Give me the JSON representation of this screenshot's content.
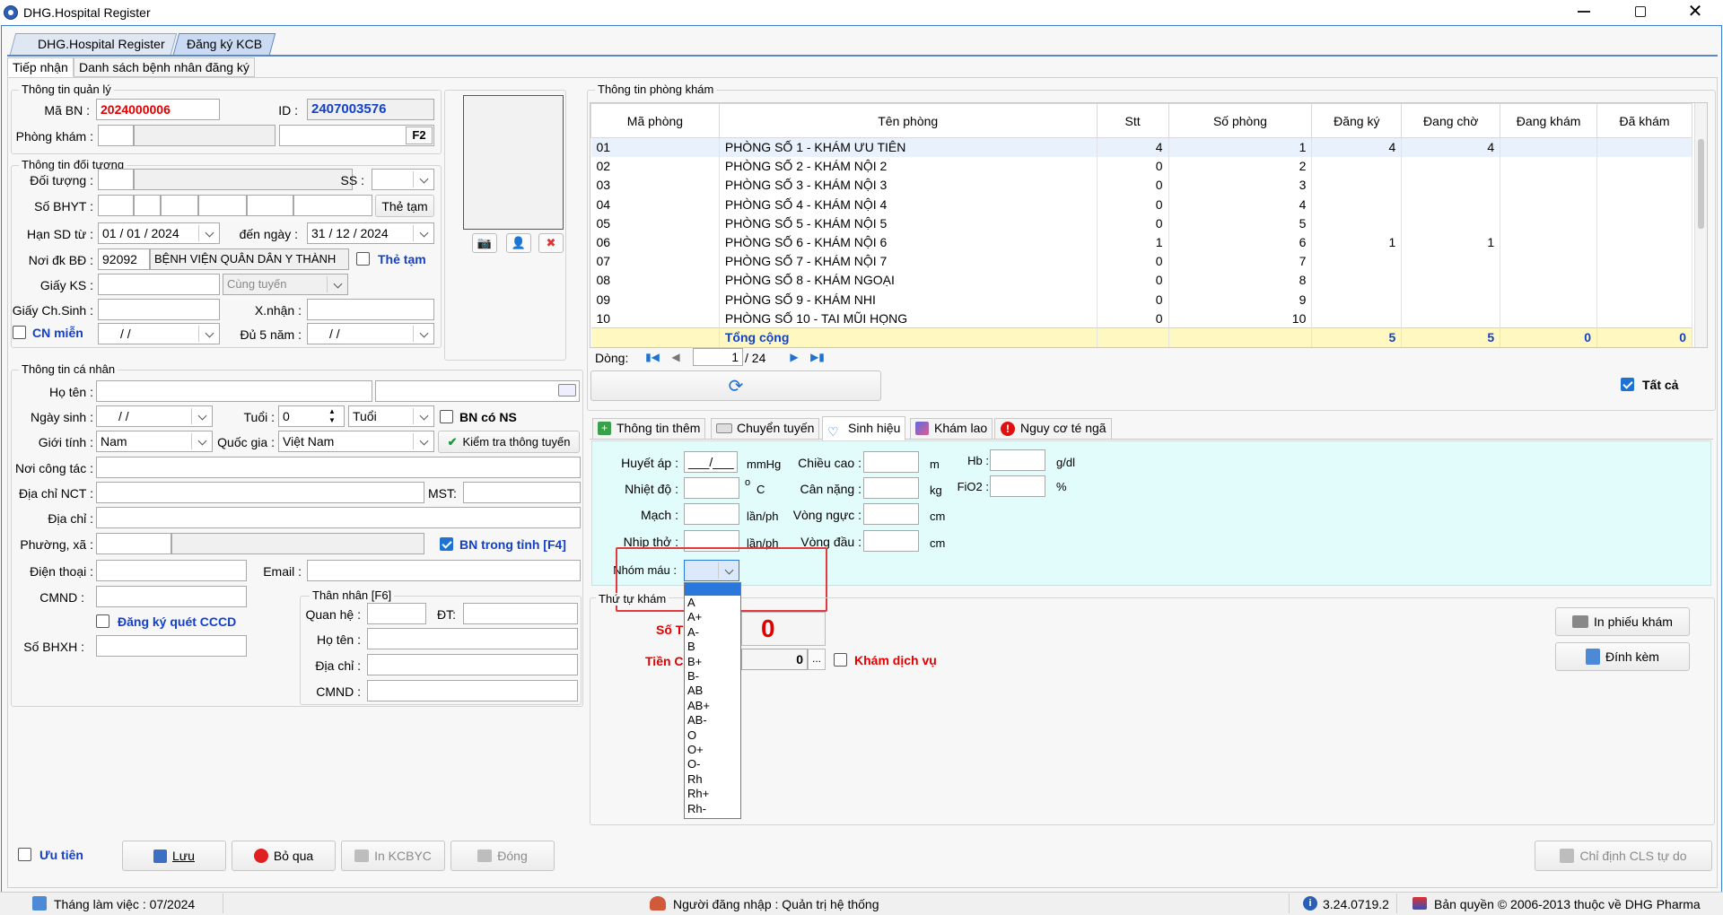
{
  "app": {
    "title": "DHG.Hospital Register",
    "tabs": [
      "DHG.Hospital Register",
      "Đăng ký KCB"
    ],
    "subtabs": [
      "Tiếp nhận",
      "Danh sách bệnh nhân đăng ký"
    ]
  },
  "quanly": {
    "title": "Thông tin quản lý",
    "ma_bn_label": "Mã BN :",
    "ma_bn": "2024000006",
    "id_label": "ID :",
    "id": "2407003576",
    "phong_kham_label": "Phòng khám :",
    "f2": "F2"
  },
  "doituong": {
    "title": "Thông tin đối tượng",
    "doi_tuong_label": "Đối tượng :",
    "ss_label": "SS :",
    "so_bhyt_label": "Số BHYT :",
    "the_tam_btn": "Thẻ tạm",
    "han_sd_label": "Hạn SD từ :",
    "han_sd_tu": "01 / 01 / 2024",
    "den_ngay_label": "đến  ngày :",
    "den_ngay": "31 / 12 / 2024",
    "noi_dk_label": "Nơi đk BĐ :",
    "noi_dk_ma": "92092",
    "noi_dk_ten": "BỆNH VIỆN QUÂN DÂN Y THÀNH",
    "the_tam_chk": "Thẻ tạm",
    "giay_ks_label": "Giấy KS :",
    "cung_tuyen": "Cùng tuyến",
    "giay_chsinh_label": "Giấy Ch.Sinh :",
    "xnhan_label": "X.nhận :",
    "cn_mien": "CN miễn",
    "date_blank": "/      /",
    "du5nam_label": "Đủ 5 năm :"
  },
  "canhan": {
    "title": "Thông tin cá nhân",
    "ho_ten_label": "Họ tên :",
    "ngay_sinh_label": "Ngày sinh :",
    "tuoi_label": "Tuổi :",
    "tuoi_val": "0",
    "tuoi_unit": "Tuổi",
    "bn_co_ns": "BN có NS",
    "gioi_tinh_label": "Giới tính :",
    "gioi_tinh": "Nam",
    "quoc_gia_label": "Quốc gia :",
    "quoc_gia": "Việt Nam",
    "kiem_tra_btn": "Kiểm tra thông tuyến",
    "noi_cong_tac_label": "Nơi công tác :",
    "dia_chi_nct_label": "Địa chỉ  NCT :",
    "mst_label": "MST:",
    "dia_chi_label": "Địa chỉ :",
    "phuong_xa_label": "Phường, xã :",
    "bn_trong_tinh": "BN trong tỉnh [F4]",
    "dien_thoai_label": "Điện thoại :",
    "email_label": "Email :",
    "cmnd_label": "CMND :",
    "dk_quet_cccd": "Đăng ký quét CCCD",
    "so_bhxh_label": "Số BHXH :"
  },
  "thannhan": {
    "title": "Thân nhân [F6]",
    "quan_he_label": "Quan hệ :",
    "dt_label": "ĐT:",
    "ho_ten_label": "Họ tên :",
    "dia_chi_label": "Địa chỉ :",
    "cmnd_label": "CMND :"
  },
  "phongkham": {
    "title": "Thông tin phòng khám",
    "columns": [
      "Mã phòng",
      "Tên phòng",
      "Stt",
      "Số phòng",
      "Đăng ký",
      "Đang chờ",
      "Đang khám",
      "Đã khám"
    ],
    "rows": [
      [
        "01",
        "PHÒNG SỐ 1 - KHÁM ƯU TIÊN",
        "4",
        "1",
        "4",
        "4",
        "",
        ""
      ],
      [
        "02",
        "PHÒNG SỐ 2 - KHÁM NỘI 2",
        "0",
        "2",
        "",
        "",
        "",
        ""
      ],
      [
        "03",
        "PHÒNG SỐ 3 - KHÁM NỘI 3",
        "0",
        "3",
        "",
        "",
        "",
        ""
      ],
      [
        "04",
        "PHÒNG SỐ 4 - KHÁM NỘI 4",
        "0",
        "4",
        "",
        "",
        "",
        ""
      ],
      [
        "05",
        "PHÒNG SỐ 5 - KHÁM NỘI 5",
        "0",
        "5",
        "",
        "",
        "",
        ""
      ],
      [
        "06",
        "PHÒNG SỐ 6 - KHÁM NỘI 6",
        "1",
        "6",
        "1",
        "1",
        "",
        ""
      ],
      [
        "07",
        "PHÒNG SỐ 7 - KHÁM NỘI 7",
        "0",
        "7",
        "",
        "",
        "",
        ""
      ],
      [
        "08",
        "PHÒNG SỐ 8 - KHÁM NGOẠI",
        "0",
        "8",
        "",
        "",
        "",
        ""
      ],
      [
        "09",
        "PHÒNG SỐ 9 - KHÁM NHI",
        "0",
        "9",
        "",
        "",
        "",
        ""
      ],
      [
        "10",
        "PHÒNG SỐ 10 - TAI MŨI HỌNG",
        "0",
        "10",
        "",
        "",
        "",
        ""
      ]
    ],
    "total_label": "Tổng cộng",
    "totals": [
      "5",
      "5",
      "0",
      "0"
    ],
    "dong_label": "Dòng:",
    "page": "1",
    "page_total": "/  24",
    "tat_ca": "Tất cả"
  },
  "subtabs2": [
    "Thông tin thêm",
    "Chuyển tuyến",
    "Sinh hiệu",
    "Khám lao",
    "Nguy cơ té ngã"
  ],
  "sinhhieu": {
    "huyet_ap_label": "Huyết áp :",
    "huyet_ap": "___/___",
    "mmhg": "mmHg",
    "chieu_cao_label": "Chiều cao :",
    "m": "m",
    "hb_label": "Hb :",
    "gdl": "g/dl",
    "nhiet_do_label": "Nhiệt độ :",
    "o": "o",
    "c": "C",
    "can_nang_label": "Cân nặng :",
    "kg": "kg",
    "fio2_label": "FiO2 :",
    "pct": "%",
    "mach_label": "Mạch :",
    "lanph": "lần/ph",
    "vong_nguc_label": "Vòng ngực :",
    "cm": "cm",
    "nhip_tho_label": "Nhịp thở :",
    "vong_dau_label": "Vòng đầu :",
    "nhom_mau_label": "Nhóm máu :",
    "blood_options": [
      "A",
      "A+",
      "A-",
      "B",
      "B+",
      "B-",
      "AB",
      "AB+",
      "AB-",
      "O",
      "O+",
      "O-",
      "Rh",
      "Rh+",
      "Rh-"
    ]
  },
  "thutu": {
    "title": "Thứ tự khám",
    "so_label": "Số T",
    "so_value": "0",
    "tien_label": "Tiền C",
    "tien_value": "0",
    "ellipsis": "...",
    "kham_dv": "Khám dịch vụ",
    "in_phieu": "In phiếu khám",
    "dinh_kem": "Đính kèm"
  },
  "bottom": {
    "uu_tien": "Ưu tiên",
    "luu": "Lưu",
    "bo_qua": "Bỏ qua",
    "in_kcbyc": "In KCBYC",
    "dong": "Đóng",
    "chi_dinh": "Chỉ định CLS tự do"
  },
  "status": {
    "thang": "Tháng làm việc : 07/2024",
    "nguoi": "Người đăng nhập : Quản trị hệ thống",
    "version": "3.24.0719.2",
    "ban_quyen": "Bản quyền © 2006-2013 thuộc về DHG Pharma"
  },
  "colors": {
    "red": "#e00000",
    "blue": "#1340c8",
    "yellow_total": "#fff8c0",
    "cyan_panel": "#e2fbfb",
    "selection": "#2a78dc"
  }
}
